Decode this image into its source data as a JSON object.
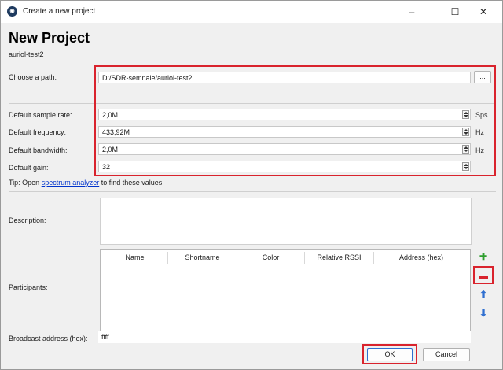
{
  "window": {
    "title": "Create a new project",
    "app_icon": "app-logo-icon"
  },
  "controls": {
    "minimize": "–",
    "maximize": "☐",
    "close": "✕"
  },
  "header": {
    "title": "New Project",
    "project_name": "auriol-test2"
  },
  "path": {
    "label": "Choose a path:",
    "value": "D:/SDR-semnale/auriol-test2",
    "browse_label": "..."
  },
  "settings": [
    {
      "label": "Default sample rate:",
      "value": "2,0M",
      "unit": "Sps"
    },
    {
      "label": "Default frequency:",
      "value": "433,92M",
      "unit": "Hz"
    },
    {
      "label": "Default bandwidth:",
      "value": "2,0M",
      "unit": "Hz"
    },
    {
      "label": "Default gain:",
      "value": "32",
      "unit": ""
    }
  ],
  "tip": {
    "before": "Tip: Open ",
    "link": "spectrum analyzer",
    "after": " to find these values."
  },
  "description": {
    "label": "Description:",
    "value": ""
  },
  "participants": {
    "label": "Participants:",
    "columns": [
      "Name",
      "Shortname",
      "Color",
      "Relative RSSI",
      "Address (hex)"
    ],
    "rows": []
  },
  "broadcast": {
    "label": "Broadcast address (hex):",
    "value": "ffff"
  },
  "buttons": {
    "ok": "OK",
    "cancel": "Cancel"
  },
  "colors": {
    "highlight": "#d9232d",
    "add": "#2e9e2e",
    "remove": "#d9232d",
    "move": "#2f6fd0"
  }
}
